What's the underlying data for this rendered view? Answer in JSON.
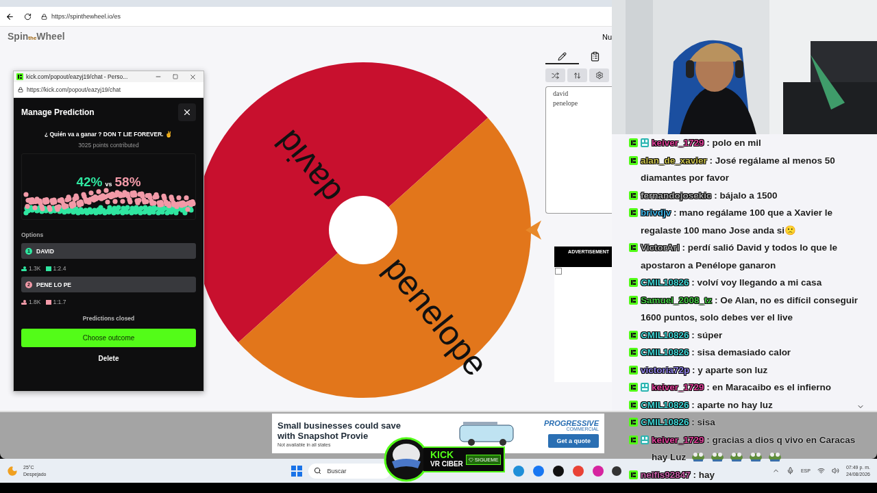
{
  "browser": {
    "url": "https://spinthewheel.io/es"
  },
  "site": {
    "logo": [
      "Spin",
      "the",
      "Wheel"
    ],
    "header_text": "Nu"
  },
  "wheel": {
    "segments": [
      {
        "label": "david",
        "color": "#c8102e"
      },
      {
        "label": "penelope",
        "color": "#e2761b"
      }
    ]
  },
  "editor": {
    "tabs": [
      {
        "kind": "pencil",
        "selected": true
      },
      {
        "kind": "clipboard",
        "selected": false
      }
    ],
    "tools": [
      {
        "kind": "shuffle"
      },
      {
        "kind": "sort"
      },
      {
        "kind": "settings"
      }
    ],
    "entries": [
      "david",
      "penelope"
    ]
  },
  "ad_panel": {
    "heading": "ADVERTISEMENT"
  },
  "popup": {
    "title": "kick.com/popout/eazyj19/chat - Perso...",
    "url": "https://kick.com/popout/eazyj19/chat",
    "heading": "Manage Prediction",
    "question": "¿ Quién va a ganar ? DON T LIE FOREVER. ✌",
    "points": "3025 points contributed",
    "percent_a": "42%",
    "vs": "vs",
    "percent_b": "58%",
    "options_label": "Options",
    "options": [
      {
        "number": "1",
        "name": "DAVID",
        "color": "#2fe6a0",
        "users": "1.3K",
        "ratio": "1:2.4"
      },
      {
        "number": "2",
        "name": "PENE LO PE",
        "color": "#f29aa8",
        "users": "1.8K",
        "ratio": "1:1.7"
      }
    ],
    "status": "Predictions closed",
    "primary_button": "Choose outcome",
    "secondary_button": "Delete"
  },
  "banner_ad": {
    "headline": "Small businesses could save",
    "headline_2": "with Snapshot Provie",
    "note": "Not available in all states",
    "brand": "PROGRESSIVE",
    "brand_sub": "COMMERCIAL",
    "button": "Get a quote"
  },
  "follow_badge": {
    "brand": "KICK",
    "name": "VR CIBER",
    "button": "SIGUEME"
  },
  "chat": [
    {
      "user": "keiver_1729",
      "color": "#e0409a",
      "subscriber": true,
      "text": ": polo en mil"
    },
    {
      "user": "alan_de_xavier",
      "color": "#c9c14e",
      "subscriber": false,
      "text": ": José regálame al menos 50 diamantes por favor"
    },
    {
      "user": "fernandojosekic",
      "color": "#a8a8a8",
      "subscriber": false,
      "text": ": bájalo a 1500"
    },
    {
      "user": "brivdjv",
      "color": "#3fb4e6",
      "subscriber": false,
      "text": ": mano regálame 100 que a Xavier le regalaste 100 mano Jose anda si🙁"
    },
    {
      "user": "VictorArl",
      "color": "#a8a8a8",
      "subscriber": false,
      "text": ": perdí salió David y todos lo que le apostaron a Penélope ganaron"
    },
    {
      "user": "CMIL10826",
      "color": "#3fd6d6",
      "subscriber": false,
      "text": ": volví voy llegando a mi casa"
    },
    {
      "user": "Samuel_2008_tz",
      "color": "#44c844",
      "subscriber": false,
      "text": ": Oe Alan, no es difícil conseguir 1600 puntos, solo debes ver el live"
    },
    {
      "user": "CMIL10826",
      "color": "#3fd6d6",
      "subscriber": false,
      "text": ": súper"
    },
    {
      "user": "CMIL10826",
      "color": "#3fd6d6",
      "subscriber": false,
      "text": ": sisa demasiado calor"
    },
    {
      "user": "victoria72p",
      "color": "#8f80e6",
      "subscriber": false,
      "text": ": y aparte son luz"
    },
    {
      "user": "keiver_1729",
      "color": "#e0409a",
      "subscriber": true,
      "text": ": en Maracaibo es el infierno"
    },
    {
      "user": "CMIL10826",
      "color": "#3fd6d6",
      "subscriber": false,
      "text": ": aparte no hay luz"
    },
    {
      "user": "CMIL10826",
      "color": "#3fd6d6",
      "subscriber": false,
      "text": ": sisa"
    },
    {
      "user": "keiver_1729",
      "color": "#e0409a",
      "subscriber": true,
      "text": ": gracias a dios q vivo en Caracas hay Luz",
      "emotes": [
        {
          "kind": "frog"
        },
        {
          "kind": "frog"
        },
        {
          "kind": "frog"
        },
        {
          "kind": "frog"
        },
        {
          "kind": "frog"
        }
      ]
    },
    {
      "user": "neifis92847",
      "color": "#c85fa8",
      "subscriber": false,
      "text": ": hay"
    }
  ],
  "taskbar": {
    "weather_temp": "25°C",
    "weather_text": "Despejado",
    "search_placeholder": "Buscar",
    "language": "ESP",
    "time": "07:49 p. m.",
    "date": "24/08/2026"
  }
}
